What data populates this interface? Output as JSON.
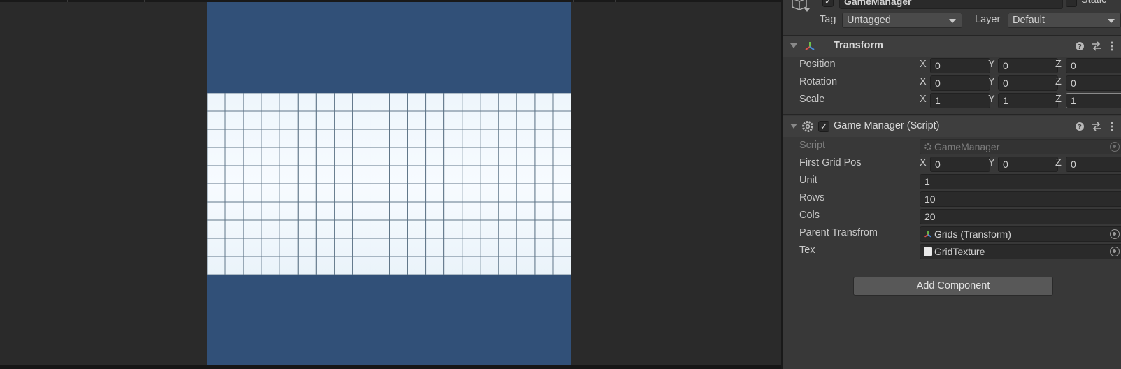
{
  "inspector": {
    "gameobject": {
      "name": "GameManager",
      "active": true,
      "static_label": "Static",
      "tag_label": "Tag",
      "tag_value": "Untagged",
      "layer_label": "Layer",
      "layer_value": "Default"
    },
    "transform": {
      "title": "Transform",
      "position": {
        "label": "Position",
        "x": "0",
        "y": "0",
        "z": "0"
      },
      "rotation": {
        "label": "Rotation",
        "x": "0",
        "y": "0",
        "z": "0"
      },
      "scale": {
        "label": "Scale",
        "x": "1",
        "y": "1",
        "z": "1"
      }
    },
    "axes": {
      "x": "X",
      "y": "Y",
      "z": "Z"
    },
    "game_manager": {
      "title": "Game Manager (Script)",
      "enabled": true,
      "script": {
        "label": "Script",
        "value": "GameManager"
      },
      "first_grid_pos": {
        "label": "First Grid Pos",
        "x": "0",
        "y": "0",
        "z": "0"
      },
      "unit": {
        "label": "Unit",
        "value": "1"
      },
      "rows": {
        "label": "Rows",
        "value": "10"
      },
      "cols": {
        "label": "Cols",
        "value": "20"
      },
      "parent_transform": {
        "label": "Parent Transfrom",
        "value": "Grids (Transform)"
      },
      "tex": {
        "label": "Tex",
        "value": "GridTexture"
      }
    },
    "add_component_label": "Add Component",
    "icons": [
      "gameobject-cube-icon",
      "transform-icon",
      "help-icon",
      "presets-icon",
      "kebab-menu-icon",
      "gear-script-icon",
      "object-picker-icon",
      "texture-icon"
    ]
  },
  "game_view": {
    "grid_rows": 10,
    "grid_cols": 20,
    "colors": {
      "background": "#315078",
      "grid_line": "#5f7588",
      "grid_fill": "#f1f8fd"
    }
  },
  "colors": {
    "inspector_bg": "#383838",
    "field_bg": "#2a2a2a",
    "accent_transform_y": "#6ec24a",
    "accent_transform_x": "#e0504a",
    "accent_transform_z": "#4a8ee0"
  }
}
